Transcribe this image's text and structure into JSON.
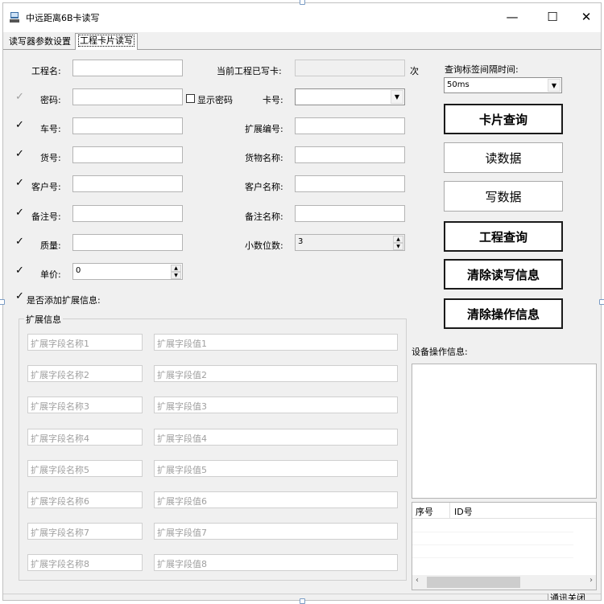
{
  "window": {
    "title": "中远距离6B卡读写",
    "controls": [
      "—",
      "☐",
      "✕"
    ]
  },
  "tabs": [
    {
      "label": "读写器参数设置",
      "active": false
    },
    {
      "label": "工程卡片读写",
      "active": true
    }
  ],
  "form": {
    "project_name_label": "工程名:",
    "password_label": "密码:",
    "show_password_label": "显示密码",
    "car_no_label": "车号:",
    "goods_no_label": "货号:",
    "customer_no_label": "客户号:",
    "remark_no_label": "备注号:",
    "quality_label": "质量:",
    "unit_price_label": "单价:",
    "unit_price_value": "0",
    "add_ext_label": "是否添加扩展信息:",
    "written_cards_label": "当前工程已写卡:",
    "written_cards_unit": "次",
    "card_no_label": "卡号:",
    "ext_no_label": "扩展编号:",
    "goods_name_label": "货物名称:",
    "customer_name_label": "客户名称:",
    "remark_name_label": "备注名称:",
    "decimals_label": "小数位数:",
    "decimals_value": "3"
  },
  "ext_group": {
    "legend": "扩展信息",
    "names": [
      "扩展字段名称1",
      "扩展字段名称2",
      "扩展字段名称3",
      "扩展字段名称4",
      "扩展字段名称5",
      "扩展字段名称6",
      "扩展字段名称7",
      "扩展字段名称8"
    ],
    "values": [
      "扩展字段值1",
      "扩展字段值2",
      "扩展字段值3",
      "扩展字段值4",
      "扩展字段值5",
      "扩展字段值6",
      "扩展字段值7",
      "扩展字段值8"
    ]
  },
  "right": {
    "query_interval_label": "查询标签间隔时间:",
    "query_interval_value": "50ms",
    "buttons": {
      "card_query": "卡片查询",
      "read_data": "读数据",
      "write_data": "写数据",
      "project_query": "工程查询",
      "clear_rw": "清除读写信息",
      "clear_ops": "清除操作信息"
    },
    "device_info_label": "设备操作信息:",
    "list_columns": [
      "序号",
      "ID号"
    ]
  },
  "status": {
    "text": "通讯关闭"
  }
}
